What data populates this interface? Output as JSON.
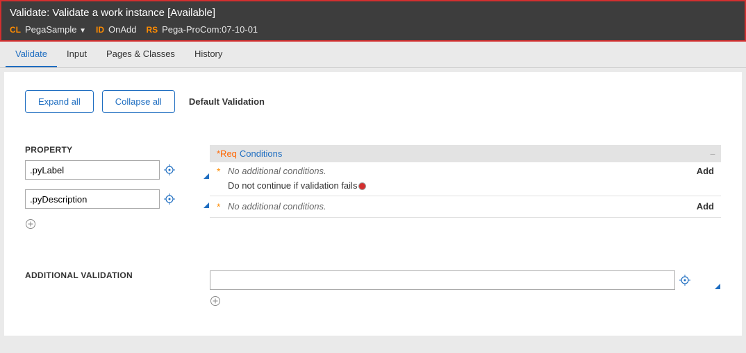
{
  "header": {
    "title": "Validate: Validate a work instance [Available]",
    "cl_key": "CL",
    "cl_val": "PegaSample",
    "id_key": "ID",
    "id_val": "OnAdd",
    "rs_key": "RS",
    "rs_val": "Pega-ProCom:07-10-01"
  },
  "tabs": {
    "validate": "Validate",
    "input": "Input",
    "pages": "Pages & Classes",
    "history": "History"
  },
  "toolbar": {
    "expand": "Expand all",
    "collapse": "Collapse all",
    "default_label": "Default Validation"
  },
  "property": {
    "section_label": "PROPERTY",
    "items": [
      {
        "value": ".pyLabel"
      },
      {
        "value": ".pyDescription"
      }
    ]
  },
  "conditions": {
    "req_label": "*Req",
    "header_link": "Conditions",
    "rows": [
      {
        "text": "No additional conditions.",
        "add_label": "Add",
        "continue_text": "Do not continue if validation fails"
      },
      {
        "text": "No additional conditions.",
        "add_label": "Add"
      }
    ]
  },
  "additional": {
    "section_label": "ADDITIONAL VALIDATION",
    "value": ""
  }
}
